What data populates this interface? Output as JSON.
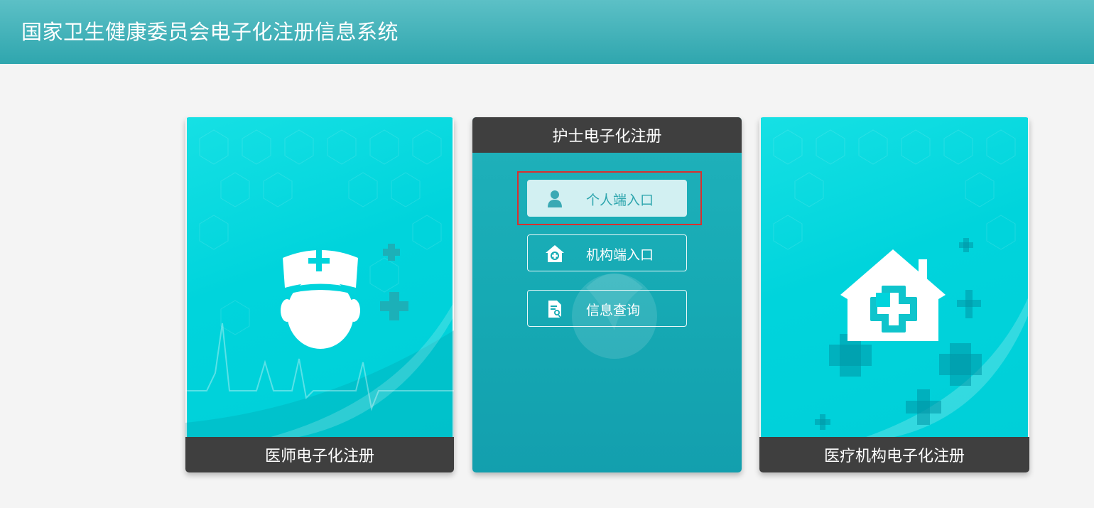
{
  "header": {
    "title": "国家卫生健康委员会电子化注册信息系统"
  },
  "cards": {
    "doctor": {
      "label": "医师电子化注册",
      "icon": "doctor-icon"
    },
    "nurse": {
      "title": "护士电子化注册",
      "buttons": [
        {
          "label": "个人端入口",
          "icon": "person-icon"
        },
        {
          "label": "机构端入口",
          "icon": "hospital-plus-icon"
        },
        {
          "label": "信息查询",
          "icon": "document-search-icon"
        }
      ]
    },
    "org": {
      "label": "医疗机构电子化注册",
      "icon": "house-cross-icon"
    }
  },
  "colors": {
    "header": "#2fa6ae",
    "card_cyan": "#00d4dc",
    "nurse_panel": "#16aab4",
    "footer": "#3f3f3f",
    "highlight": "#d9302f"
  }
}
